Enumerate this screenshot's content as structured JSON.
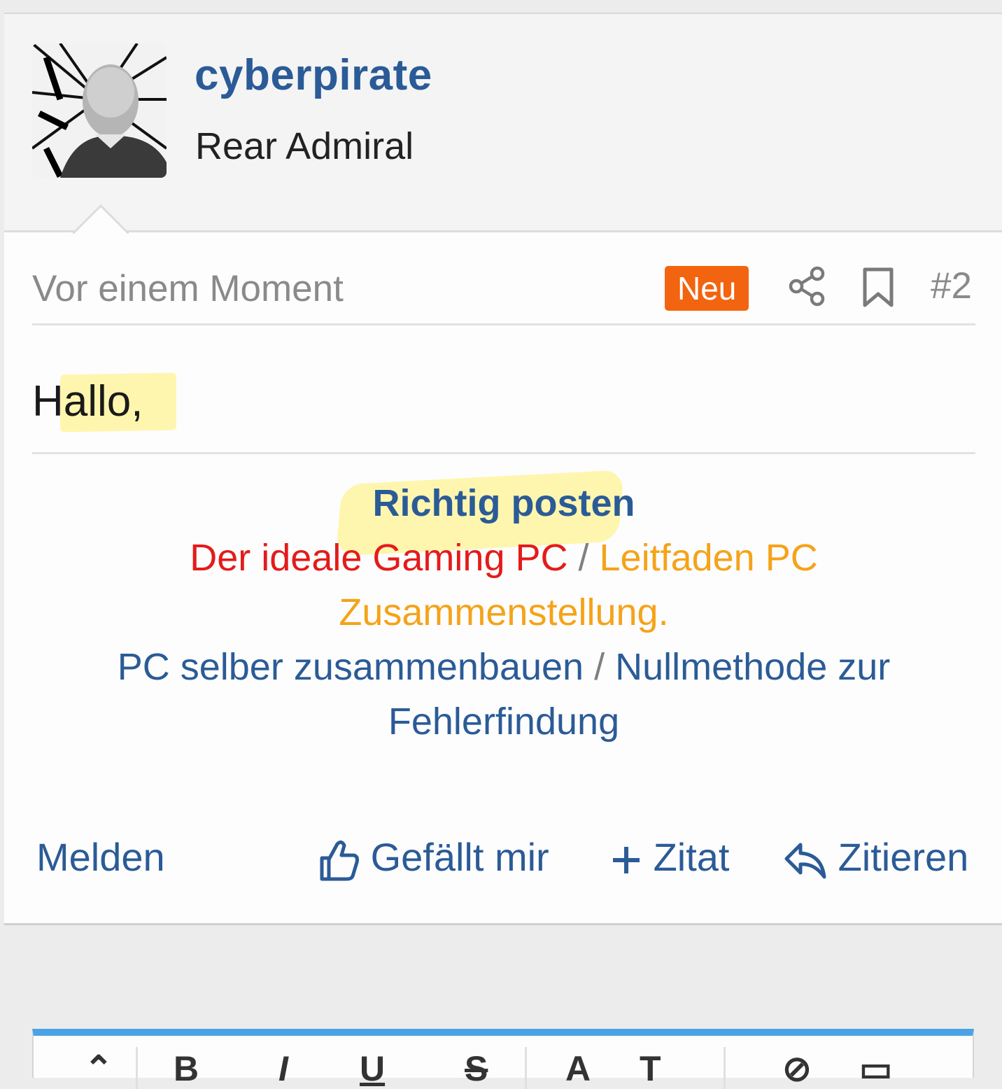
{
  "post": {
    "username": "cyberpirate",
    "user_title": "Rear Admiral",
    "timestamp": "Vor einem Moment",
    "badge": "Neu",
    "post_number": "#2",
    "body": "Hallo,",
    "signature": {
      "title": "Richtig posten",
      "link_gaming_pc": "Der ideale Gaming PC",
      "slash1": " / ",
      "link_leitfaden_1": "Leitfaden PC",
      "link_leitfaden_2": "Zusammenstellung",
      "dot": ".",
      "link_selber": "PC selber zusammenbauen",
      "slash2": " / ",
      "link_nullmethode_1": "Nullmethode zur",
      "link_nullmethode_2": "Fehlerfindung"
    },
    "actions": {
      "report": "Melden",
      "like": "Gefällt mir",
      "add_quote": "Zitat",
      "quote": "Zitieren"
    }
  },
  "icons": {
    "share": "share-icon",
    "bookmark": "bookmark-icon",
    "like": "thumbs-up-icon",
    "plus": "plus-icon",
    "reply": "reply-icon"
  },
  "colors": {
    "link_blue": "#2b5b97",
    "badge_orange": "#f2640f",
    "signature_red": "#e41b1b",
    "signature_orange": "#f5a31a",
    "editor_accent": "#4aa3e6",
    "highlight": "#fff06e"
  }
}
